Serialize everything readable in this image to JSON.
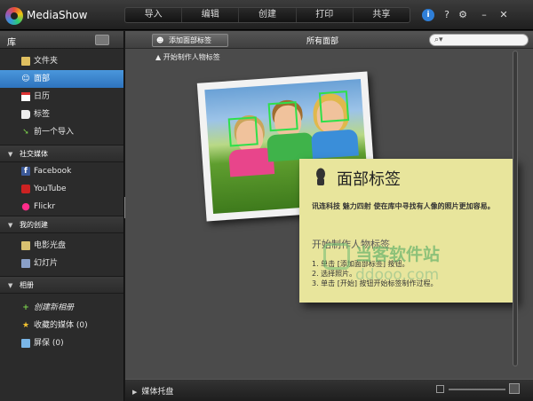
{
  "app": {
    "title": "MediaShow"
  },
  "main_tabs": [
    "导入",
    "编辑",
    "创建",
    "打印",
    "共享"
  ],
  "window_controls": {
    "help": "i",
    "help_icon": "info-icon",
    "maximize": "?",
    "settings": "⚙",
    "minimize": "–",
    "close": "✕"
  },
  "sidebar": {
    "library_title": "库",
    "library_items": [
      {
        "label": "文件夹",
        "icon": "folder-icon"
      },
      {
        "label": "面部",
        "icon": "face-icon"
      },
      {
        "label": "日历",
        "icon": "calendar-icon"
      },
      {
        "label": "标签",
        "icon": "tag-icon"
      },
      {
        "label": "前一个导入",
        "icon": "import-arrow-icon"
      }
    ],
    "social_title": "社交媒体",
    "social_items": [
      {
        "label": "Facebook",
        "icon": "facebook-icon"
      },
      {
        "label": "YouTube",
        "icon": "youtube-icon"
      },
      {
        "label": "Flickr",
        "icon": "flickr-icon"
      }
    ],
    "creations_title": "我的创建",
    "creations_items": [
      {
        "label": "电影光盘",
        "icon": "movie-disc-icon"
      },
      {
        "label": "幻灯片",
        "icon": "slideshow-icon"
      }
    ],
    "albums_title": "相册",
    "albums_items": [
      {
        "label": "创建新相册",
        "icon": "add-icon"
      },
      {
        "label": "收藏的媒体 (0)",
        "icon": "star-icon"
      },
      {
        "label": "屏保 (0)",
        "icon": "screensaver-icon"
      }
    ]
  },
  "toolbar": {
    "add_face_tag": "添加面部标签",
    "all_faces": "所有面部",
    "search_placeholder": ""
  },
  "content": {
    "start_link": "▲ 开始制作人物标签",
    "note": {
      "title": "面部标签",
      "description": "讯连科技 魅力四射 使在库中寻找有人像的照片更加容易。",
      "subtitle": "开始制作人物标签",
      "steps": [
        "1. 单击 [添加面部标签] 按钮。",
        "2. 选择照片。",
        "3. 单击 [开始] 按钮开始标签制作过程。"
      ]
    },
    "watermark": {
      "main": "当客软件站",
      "url": "ddooo.com"
    }
  },
  "bottom": {
    "media_tray": "媒体托盘"
  },
  "colors": {
    "selected": "#3b87cf",
    "face_box": "#2ee04a",
    "note_bg": "#e8e59c"
  }
}
